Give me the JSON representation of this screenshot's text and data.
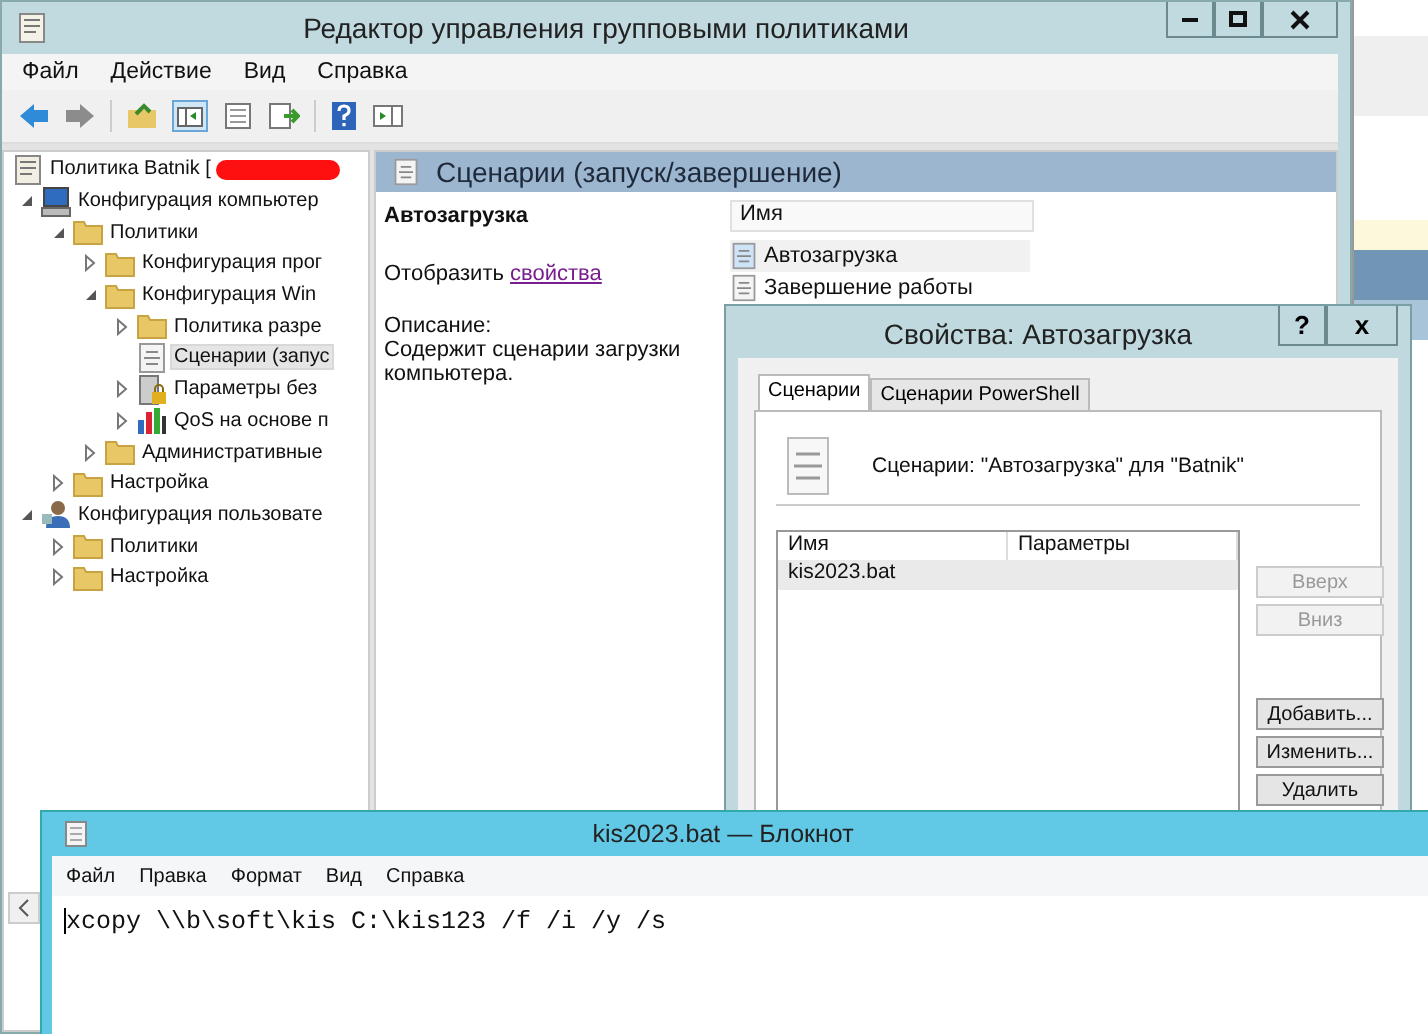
{
  "editor": {
    "title": "Редактор управления групповыми политиками",
    "menu": [
      "Файл",
      "Действие",
      "Вид",
      "Справка"
    ],
    "tree": [
      {
        "label": "Политика Batnik [",
        "kind": "document",
        "selected": false,
        "redacted": true,
        "children": [
          {
            "label": "Конфигурация компьютер",
            "kind": "computer",
            "expanded": true,
            "selected": false,
            "children": [
              {
                "label": "Политики",
                "kind": "folder",
                "expanded": true,
                "selected": false,
                "children": [
                  {
                    "label": "Конфигурация прог",
                    "kind": "folder",
                    "expanded": false,
                    "selected": false
                  },
                  {
                    "label": "Конфигурация Win",
                    "kind": "folder",
                    "expanded": true,
                    "selected": false,
                    "children": [
                      {
                        "label": "Политика разре",
                        "kind": "folder",
                        "expanded": false,
                        "selected": false
                      },
                      {
                        "label": "Сценарии (запус",
                        "kind": "script",
                        "selected": true
                      },
                      {
                        "label": "Параметры без",
                        "kind": "security",
                        "expanded": false,
                        "selected": false
                      },
                      {
                        "label": "QoS на основе п",
                        "kind": "chart",
                        "expanded": false,
                        "selected": false
                      }
                    ]
                  },
                  {
                    "label": "Административные",
                    "kind": "folder",
                    "expanded": false,
                    "selected": false
                  }
                ]
              },
              {
                "label": "Настройка",
                "kind": "folder",
                "expanded": false,
                "selected": false
              }
            ]
          },
          {
            "label": "Конфигурация пользовате",
            "kind": "user",
            "expanded": true,
            "selected": false,
            "children": [
              {
                "label": "Политики",
                "kind": "folder",
                "expanded": false,
                "selected": false
              },
              {
                "label": "Настройка",
                "kind": "folder",
                "expanded": false,
                "selected": false
              }
            ]
          }
        ]
      }
    ],
    "pane_title": "Сценарии (запуск/завершение)",
    "detail_heading": "Автозагрузка",
    "detail_prefix": "Отобразить ",
    "detail_link": "свойства",
    "description_label": "Описание:",
    "description": "Содержит сценарии загрузки компьютера.",
    "list_column": "Имя",
    "list_items": [
      {
        "label": "Автозагрузка",
        "selected": true
      },
      {
        "label": "Завершение работы",
        "selected": false
      }
    ]
  },
  "dialog": {
    "title": "Свойства: Автозагрузка",
    "help": "?",
    "close": "x",
    "tabs": [
      {
        "label": "Сценарии",
        "selected": true
      },
      {
        "label": "Сценарии PowerShell",
        "selected": false
      }
    ],
    "heading": "Сценарии: \"Автозагрузка\" для \"Batnik\"",
    "columns": [
      "Имя",
      "Параметры"
    ],
    "rows": [
      {
        "name": "kis2023.bat",
        "selected": true
      }
    ],
    "buttons": [
      {
        "label": "Вверх",
        "disabled": true
      },
      {
        "label": "Вниз",
        "disabled": true
      },
      {
        "label": "Добавить...",
        "disabled": false
      },
      {
        "label": "Изменить...",
        "disabled": false
      },
      {
        "label": "Удалить",
        "disabled": false
      }
    ]
  },
  "notepad": {
    "title": "kis2023.bat — Блокнот",
    "menu": [
      "Файл",
      "Правка",
      "Формат",
      "Вид",
      "Справка"
    ],
    "content": "xcopy \\\\b\\soft\\kis C:\\kis123 /f /i /y /s"
  }
}
